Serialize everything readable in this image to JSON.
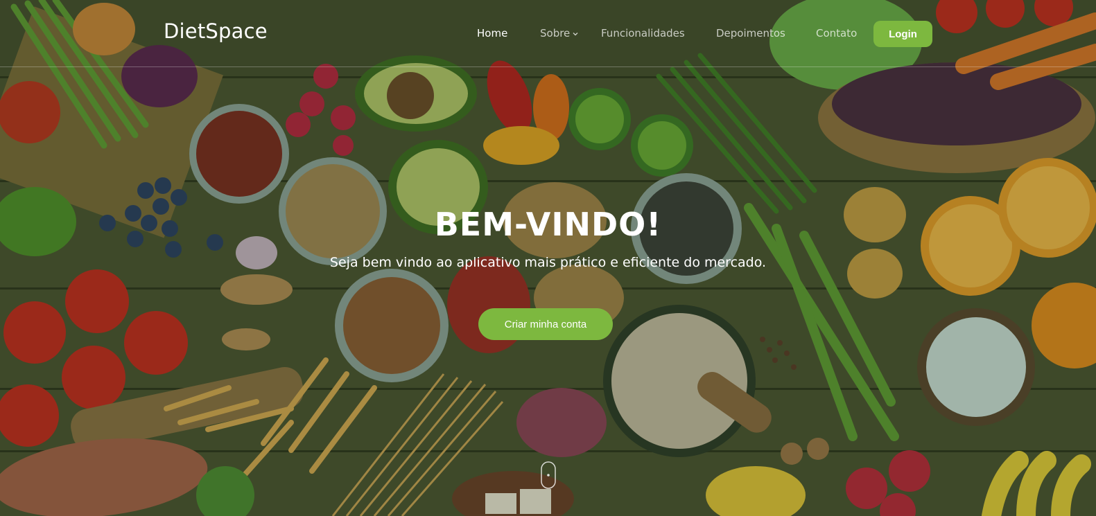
{
  "brand": {
    "name": "DietSpace"
  },
  "nav": {
    "items": [
      {
        "label": "Home",
        "active": true
      },
      {
        "label": "Sobre",
        "has_dropdown": true
      },
      {
        "label": "Funcionalidades"
      },
      {
        "label": "Depoimentos"
      },
      {
        "label": "Contato"
      }
    ],
    "login_label": "Login"
  },
  "hero": {
    "title": "BEM-VINDO!",
    "subtitle": "Seja bem vindo ao aplicativo mais prático e eficiente do mercado.",
    "cta_label": "Criar minha conta"
  },
  "colors": {
    "accent": "#7db83f",
    "text": "#ffffff"
  },
  "icons": {
    "sobre_dropdown": "chevron-down-icon",
    "scroll": "mouse-scroll-icon"
  }
}
